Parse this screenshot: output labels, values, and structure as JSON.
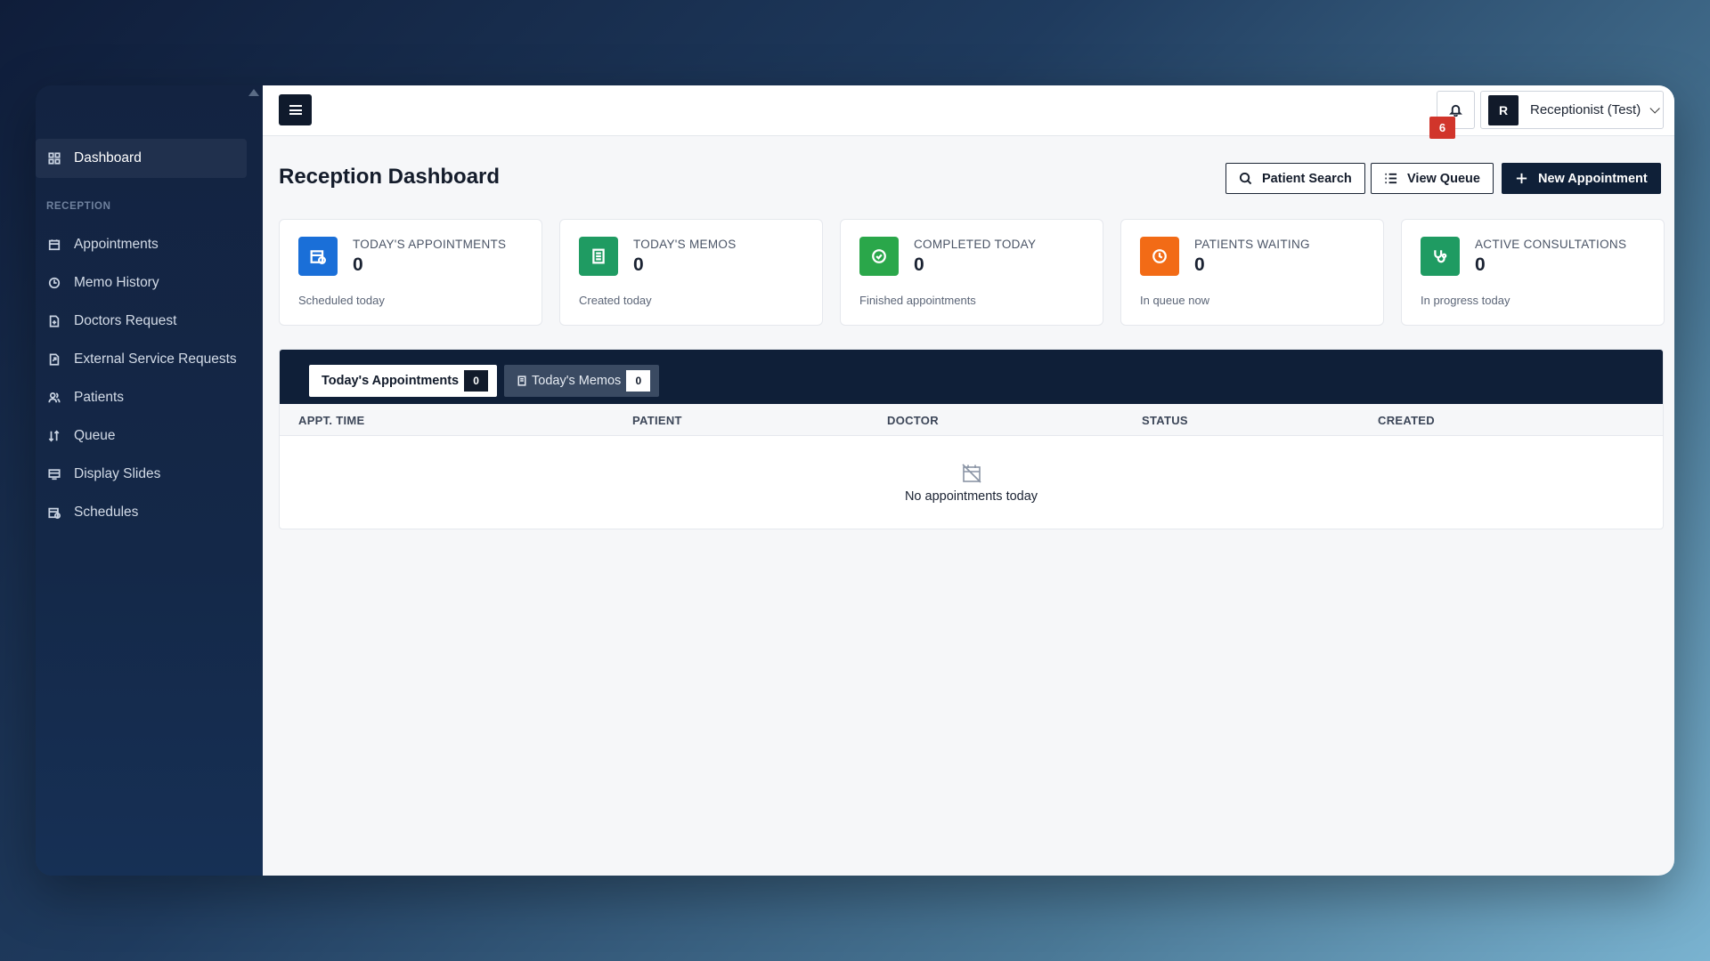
{
  "sidebar": {
    "items": [
      {
        "label": "Dashboard",
        "icon": "dashboard-icon"
      },
      {
        "label": "Appointments",
        "icon": "calendar-icon"
      },
      {
        "label": "Memo History",
        "icon": "history-icon"
      },
      {
        "label": "Doctors Request",
        "icon": "file-icon"
      },
      {
        "label": "External Service Requests",
        "icon": "external-icon"
      },
      {
        "label": "Patients",
        "icon": "users-icon"
      },
      {
        "label": "Queue",
        "icon": "sort-icon"
      },
      {
        "label": "Display Slides",
        "icon": "slides-icon"
      },
      {
        "label": "Schedules",
        "icon": "schedule-icon"
      }
    ],
    "section_label": "RECEPTION"
  },
  "topbar": {
    "notification_count": "6",
    "user_initial": "R",
    "user_name": "Receptionist (Test)"
  },
  "page": {
    "title": "Reception Dashboard",
    "actions": {
      "patient_search": "Patient Search",
      "view_queue": "View Queue",
      "new_appointment": "New Appointment"
    }
  },
  "stats": [
    {
      "label": "TODAY'S APPOINTMENTS",
      "value": "0",
      "sub": "Scheduled today",
      "color": "#1a6fd8"
    },
    {
      "label": "TODAY'S MEMOS",
      "value": "0",
      "sub": "Created today",
      "color": "#1f9b62"
    },
    {
      "label": "COMPLETED TODAY",
      "value": "0",
      "sub": "Finished appointments",
      "color": "#2aa74a"
    },
    {
      "label": "PATIENTS WAITING",
      "value": "0",
      "sub": "In queue now",
      "color": "#f26b16"
    },
    {
      "label": "ACTIVE CONSULTATIONS",
      "value": "0",
      "sub": "In progress today",
      "color": "#1f9b62"
    }
  ],
  "tabs": [
    {
      "label": "Today's Appointments",
      "count": "0"
    },
    {
      "label": "Today's Memos",
      "count": "0"
    }
  ],
  "table": {
    "columns": [
      "APPT. TIME",
      "PATIENT",
      "DOCTOR",
      "STATUS",
      "CREATED"
    ],
    "empty_text": "No appointments today"
  }
}
